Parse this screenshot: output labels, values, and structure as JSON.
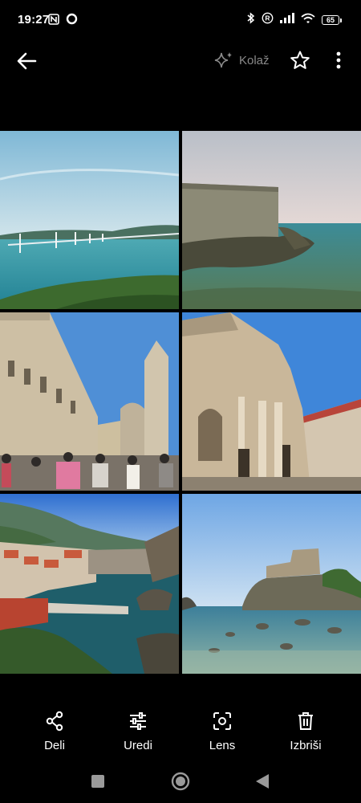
{
  "status_bar": {
    "time": "19:27",
    "icons": [
      "nfc-icon",
      "record-icon",
      "bluetooth-icon",
      "registered-icon",
      "signal-icon",
      "wifi-icon"
    ],
    "battery": "65"
  },
  "app_bar": {
    "back_icon": "arrow-back-icon",
    "collage_label": "Kolaž",
    "collage_icon": "sparkle-icon",
    "favorite_icon": "star-outline-icon",
    "more_icon": "more-vert-icon"
  },
  "photos": [
    {
      "subject": "bridge-over-bay"
    },
    {
      "subject": "coastal-fortress"
    },
    {
      "subject": "old-town-street"
    },
    {
      "subject": "baroque-church"
    },
    {
      "subject": "harbour-view"
    },
    {
      "subject": "fortress-on-rock"
    }
  ],
  "actions": [
    {
      "label": "Deli",
      "icon": "share-icon"
    },
    {
      "label": "Uredi",
      "icon": "tune-icon"
    },
    {
      "label": "Lens",
      "icon": "lens-icon"
    },
    {
      "label": "Izbriši",
      "icon": "delete-icon"
    }
  ],
  "nav_bar": {
    "icons": [
      "recents-icon",
      "home-icon",
      "back-triangle-icon"
    ]
  }
}
